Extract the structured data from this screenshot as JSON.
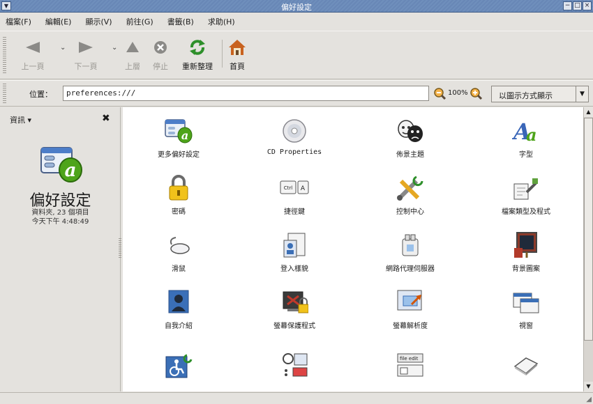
{
  "window": {
    "title": "偏好設定",
    "menu_glyph": "▼",
    "min": "−",
    "max": "□",
    "close": "×"
  },
  "menubar": [
    {
      "label": "檔案(F)"
    },
    {
      "label": "編輯(E)"
    },
    {
      "label": "顯示(V)"
    },
    {
      "label": "前往(G)"
    },
    {
      "label": "書籤(B)"
    },
    {
      "label": "求助(H)"
    }
  ],
  "toolbar": {
    "back": "上一頁",
    "forward": "下一頁",
    "up": "上層",
    "stop": "停止",
    "reload": "重新整理",
    "home": "首頁"
  },
  "location": {
    "label": "位置：",
    "value": "preferences:///",
    "zoom": "100%"
  },
  "view_as": {
    "label": "以圖示方式顯示",
    "arrow": "▼"
  },
  "sidepane": {
    "select": "資訊 ▾",
    "close": "✖",
    "title": "偏好設定",
    "info_line1": "資料夾, 23 個項目",
    "info_line2": "今天下午 4:48:49"
  },
  "items": [
    {
      "label": "更多偏好設定",
      "icon": "more-preferences-icon"
    },
    {
      "label": "CD Properties",
      "icon": "cd-icon"
    },
    {
      "label": "佈景主題",
      "icon": "theme-masks-icon"
    },
    {
      "label": "字型",
      "icon": "font-icon"
    },
    {
      "label": "密碼",
      "icon": "padlock-icon"
    },
    {
      "label": "捷徑鍵",
      "icon": "keyboard-shortcut-icon"
    },
    {
      "label": "控制中心",
      "icon": "control-center-tools-icon"
    },
    {
      "label": "檔案類型及程式",
      "icon": "file-types-icon"
    },
    {
      "label": "滑鼠",
      "icon": "mouse-icon"
    },
    {
      "label": "登入樣貌",
      "icon": "login-screen-icon"
    },
    {
      "label": "網路代理伺服器",
      "icon": "network-proxy-icon"
    },
    {
      "label": "背景圖案",
      "icon": "background-icon"
    },
    {
      "label": "自我介紹",
      "icon": "about-me-icon"
    },
    {
      "label": "螢幕保護程式",
      "icon": "screensaver-icon"
    },
    {
      "label": "螢幕解析度",
      "icon": "screen-resolution-icon"
    },
    {
      "label": "視窗",
      "icon": "windows-icon"
    },
    {
      "label": "",
      "icon": "accessibility-icon"
    },
    {
      "label": "",
      "icon": "search-tool-icon"
    },
    {
      "label": "",
      "icon": "menu-toolbar-icon"
    },
    {
      "label": "",
      "icon": "keyboard-key-icon"
    }
  ],
  "colors": {
    "titlebar": "#6f8fbc",
    "window_bg": "#e4e2de",
    "content_bg": "#ffffff",
    "preferences_green": "#4ea41a"
  }
}
